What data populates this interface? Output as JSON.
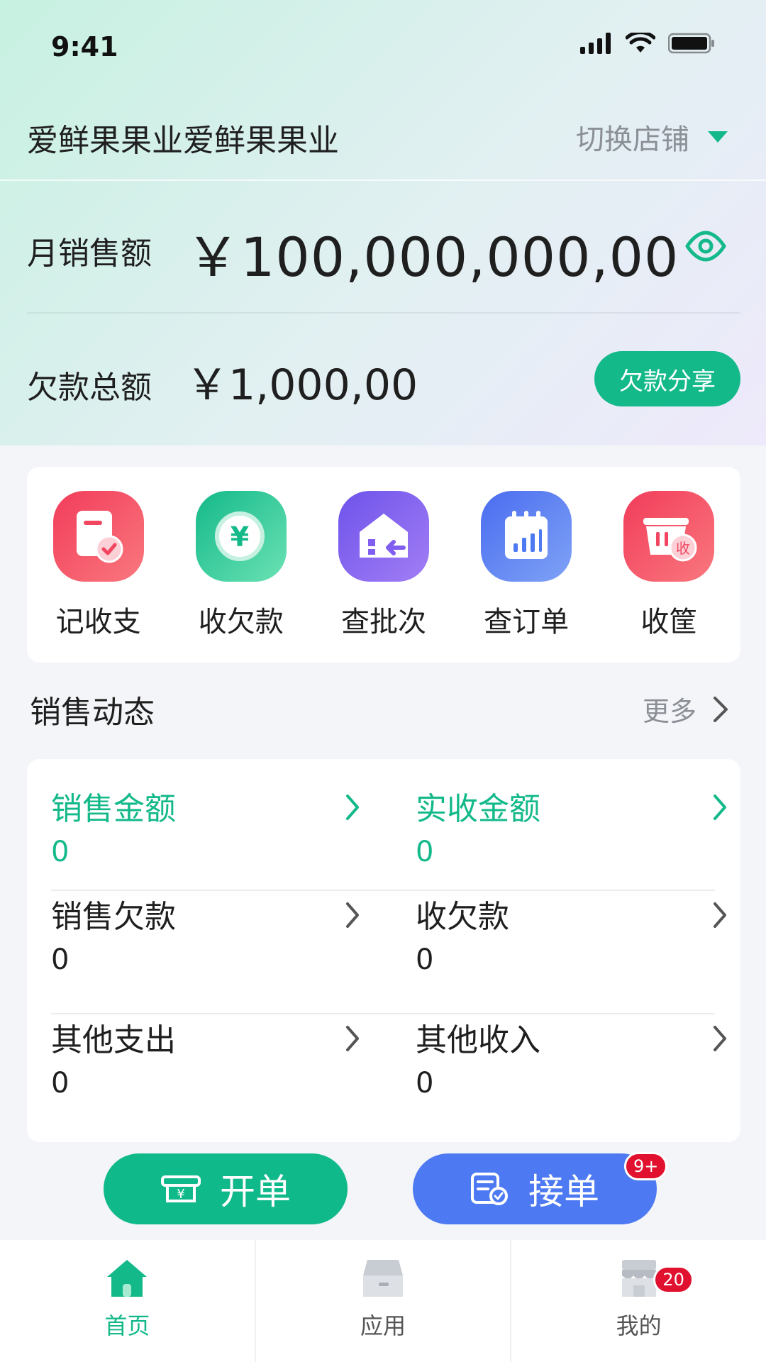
{
  "status_bar": {
    "time": "9:41"
  },
  "store": {
    "name": "爱鲜果果业爱鲜果果业",
    "switch_label": "切换店铺"
  },
  "summary": {
    "monthly_sales_label": "月销售额",
    "monthly_sales_value": "￥100,000,000,00",
    "total_debt_label": "欠款总额",
    "total_debt_value": "￥1,000,00",
    "share_debt_label": "欠款分享"
  },
  "quick_actions": [
    {
      "label": "记收支",
      "icon": "ledger-icon",
      "color": "#f24660"
    },
    {
      "label": "收欠款",
      "icon": "yuan-coin-icon",
      "color": "#1ebf8f"
    },
    {
      "label": "查批次",
      "icon": "warehouse-icon",
      "color": "#7f5ef0"
    },
    {
      "label": "查订单",
      "icon": "calendar-chart-icon",
      "color": "#4d7af2"
    },
    {
      "label": "收筐",
      "icon": "basket-icon",
      "color": "#f24660",
      "icon_text": "收"
    }
  ],
  "sales_activity": {
    "title": "销售动态",
    "more_label": "更多",
    "stats": [
      {
        "label": "销售金额",
        "value": "0"
      },
      {
        "label": "实收金额",
        "value": "0"
      },
      {
        "label": "销售欠款",
        "value": "0"
      },
      {
        "label": "收欠款",
        "value": "0"
      },
      {
        "label": "其他支出",
        "value": "0"
      },
      {
        "label": "其他收入",
        "value": "0"
      }
    ]
  },
  "buttons": {
    "open_order": "开单",
    "take_order": "接单",
    "take_order_badge": "9+"
  },
  "tabbar": {
    "items": [
      {
        "label": "首页",
        "icon": "home-icon"
      },
      {
        "label": "应用",
        "icon": "drawer-icon"
      },
      {
        "label": "我的",
        "icon": "store-icon",
        "badge": "20"
      }
    ]
  },
  "colors": {
    "primary_green": "#14b98a",
    "primary_blue": "#4d7af2",
    "badge_red": "#e0102e"
  }
}
